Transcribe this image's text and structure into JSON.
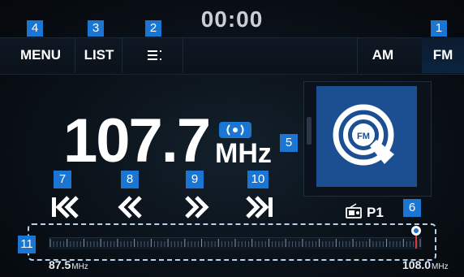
{
  "clock": "00:00",
  "tabs": {
    "menu": {
      "label": "MENU",
      "badge": "4"
    },
    "list": {
      "label": "LIST",
      "badge": "3"
    },
    "options": {
      "badge": "2"
    },
    "am": {
      "label": "AM"
    },
    "fm": {
      "label": "FM",
      "badge": "1"
    }
  },
  "frequency": {
    "value": "107.7",
    "unit": "MHz",
    "badge": "5"
  },
  "album_art": {
    "logo_text": "FM"
  },
  "controls": [
    {
      "badge": "7",
      "icon": "seek-previous-icon"
    },
    {
      "badge": "8",
      "icon": "rewind-icon"
    },
    {
      "badge": "9",
      "icon": "fast-forward-icon"
    },
    {
      "badge": "10",
      "icon": "seek-next-icon"
    }
  ],
  "preset": {
    "label": "P1",
    "badge": "6"
  },
  "tuner": {
    "badge": "11",
    "min": "87.5",
    "max": "108.0",
    "unit": "MHz",
    "value": 107.7
  },
  "colors": {
    "badge": "#1a76d2",
    "accent": "#1c4f92"
  }
}
